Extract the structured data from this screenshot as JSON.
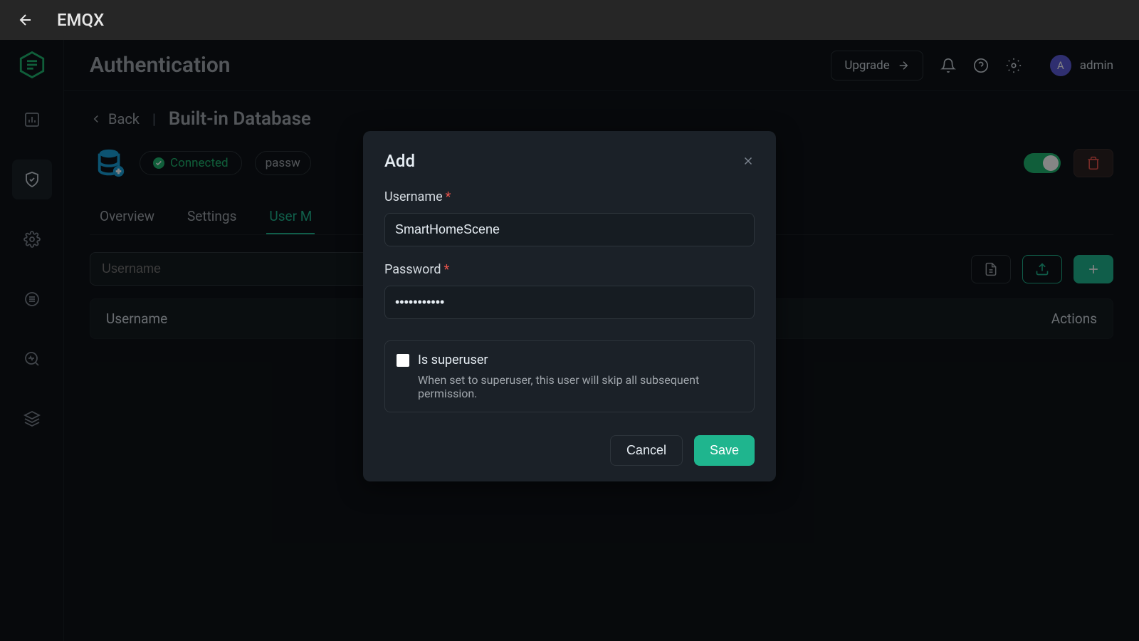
{
  "os": {
    "title": "EMQX"
  },
  "header": {
    "page_title": "Authentication",
    "upgrade": "Upgrade",
    "user_initial": "A",
    "user_name": "admin"
  },
  "breadcrumb": {
    "back": "Back",
    "current": "Built-in Database"
  },
  "status": {
    "connected": "Connected",
    "passw": "passw"
  },
  "tabs": {
    "overview": "Overview",
    "settings": "Settings",
    "user_mgmt": "User M"
  },
  "search": {
    "placeholder": "Username"
  },
  "table": {
    "col_username": "Username",
    "col_actions": "Actions"
  },
  "modal": {
    "title": "Add",
    "username_label": "Username",
    "password_label": "Password",
    "username_value": "SmartHomeScene",
    "password_value": "•••••••••••",
    "superuser_label": "Is superuser",
    "superuser_desc": "When set to superuser, this user will skip all subsequent permission.",
    "cancel": "Cancel",
    "save": "Save"
  },
  "colors": {
    "accent": "#1fb58e",
    "danger": "#e5534b"
  }
}
